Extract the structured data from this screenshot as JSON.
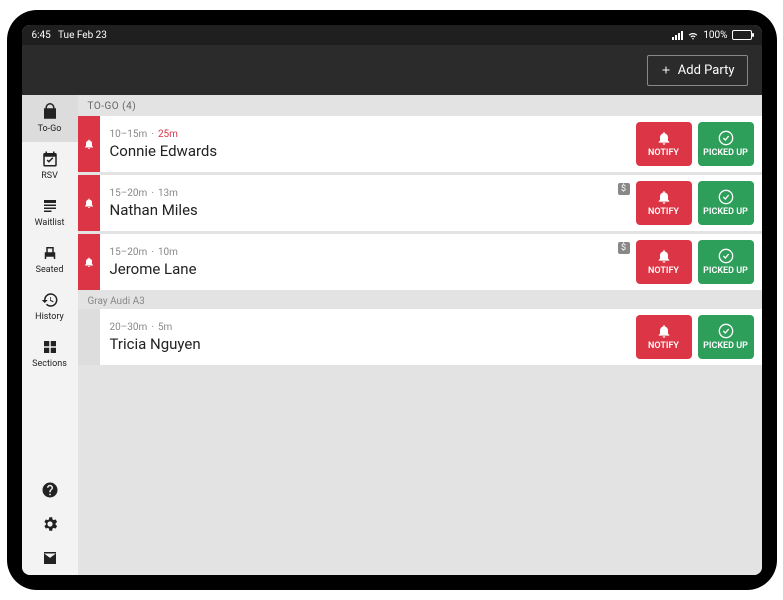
{
  "status": {
    "time": "6:45",
    "date": "Tue Feb 23",
    "battery": "100%"
  },
  "topbar": {
    "add_party": "Add Party"
  },
  "sidebar": {
    "items": [
      {
        "id": "togo",
        "label": "To-Go"
      },
      {
        "id": "rsv",
        "label": "RSV"
      },
      {
        "id": "waitlist",
        "label": "Waitlist"
      },
      {
        "id": "seated",
        "label": "Seated"
      },
      {
        "id": "history",
        "label": "History"
      },
      {
        "id": "sections",
        "label": "Sections"
      }
    ]
  },
  "list": {
    "header": "TO-GO (4)",
    "rows": [
      {
        "quote": "10–15m",
        "sep": "·",
        "wait": "25m",
        "overdue": true,
        "name": "Connie Edwards",
        "has_bell": true,
        "has_dollar": false,
        "sub_header": ""
      },
      {
        "quote": "15–20m",
        "sep": "·",
        "wait": "13m",
        "overdue": false,
        "name": "Nathan Miles",
        "has_bell": true,
        "has_dollar": true,
        "sub_header": ""
      },
      {
        "quote": "15–20m",
        "sep": "·",
        "wait": "10m",
        "overdue": false,
        "name": "Jerome Lane",
        "has_bell": true,
        "has_dollar": true,
        "sub_header": ""
      },
      {
        "quote": "20–30m",
        "sep": "·",
        "wait": "5m",
        "overdue": false,
        "name": "Tricia Nguyen",
        "has_bell": false,
        "has_dollar": false,
        "sub_header": "Gray Audi A3"
      }
    ]
  },
  "buttons": {
    "notify": "NOTIFY",
    "picked": "PICKED UP"
  },
  "icons": {
    "dollar": "$"
  }
}
